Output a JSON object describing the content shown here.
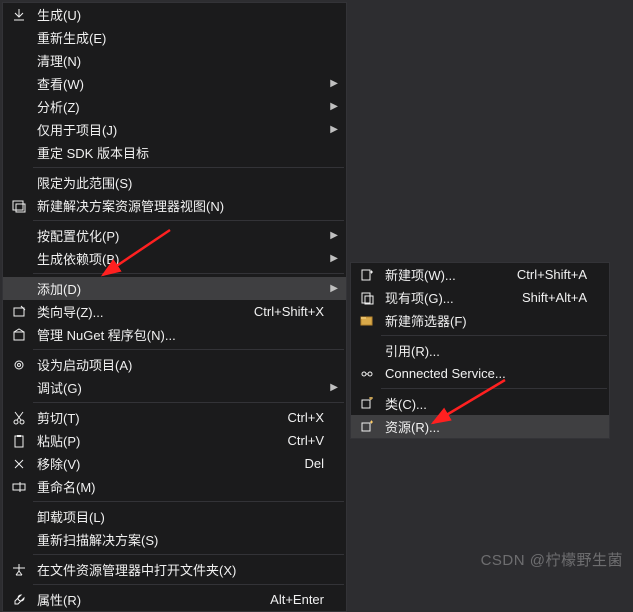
{
  "mainMenu": {
    "items": [
      {
        "id": "build",
        "label": "生成(U)",
        "icon": "build-icon",
        "sub": false
      },
      {
        "id": "rebuild",
        "label": "重新生成(E)",
        "icon": "",
        "sub": false
      },
      {
        "id": "clean",
        "label": "清理(N)",
        "icon": "",
        "sub": false
      },
      {
        "id": "view",
        "label": "查看(W)",
        "icon": "",
        "sub": true
      },
      {
        "id": "analyze",
        "label": "分析(Z)",
        "icon": "",
        "sub": true
      },
      {
        "id": "project-only",
        "label": "仅用于项目(J)",
        "icon": "",
        "sub": true
      },
      {
        "id": "retarget-sdk",
        "label": "重定 SDK 版本目标",
        "icon": "",
        "sub": false
      },
      {
        "sep": true
      },
      {
        "id": "scope",
        "label": "限定为此范围(S)",
        "icon": "",
        "sub": false
      },
      {
        "id": "new-view",
        "label": "新建解决方案资源管理器视图(N)",
        "icon": "newview-icon",
        "sub": false
      },
      {
        "sep": true
      },
      {
        "id": "pgo",
        "label": "按配置优化(P)",
        "icon": "",
        "sub": true
      },
      {
        "id": "build-deps",
        "label": "生成依赖项(B)",
        "icon": "",
        "sub": true
      },
      {
        "sep": true
      },
      {
        "id": "add",
        "label": "添加(D)",
        "icon": "",
        "sub": true,
        "highlight": true
      },
      {
        "id": "class-wizard",
        "label": "类向导(Z)...",
        "icon": "wizard-icon",
        "shortcut": "Ctrl+Shift+X"
      },
      {
        "id": "nuget",
        "label": "管理 NuGet 程序包(N)...",
        "icon": "nuget-icon",
        "sub": false
      },
      {
        "sep": true
      },
      {
        "id": "startup",
        "label": "设为启动项目(A)",
        "icon": "gear-icon",
        "sub": false
      },
      {
        "id": "debug",
        "label": "调试(G)",
        "icon": "",
        "sub": true
      },
      {
        "sep": true
      },
      {
        "id": "cut",
        "label": "剪切(T)",
        "icon": "cut-icon",
        "shortcut": "Ctrl+X"
      },
      {
        "id": "paste",
        "label": "粘贴(P)",
        "icon": "paste-icon",
        "shortcut": "Ctrl+V"
      },
      {
        "id": "remove",
        "label": "移除(V)",
        "icon": "remove-icon",
        "shortcut": "Del"
      },
      {
        "id": "rename",
        "label": "重命名(M)",
        "icon": "rename-icon",
        "sub": false
      },
      {
        "sep": true
      },
      {
        "id": "unload",
        "label": "卸载项目(L)",
        "icon": "",
        "sub": false
      },
      {
        "id": "rescan",
        "label": "重新扫描解决方案(S)",
        "icon": "",
        "sub": false
      },
      {
        "sep": true
      },
      {
        "id": "open-explorer",
        "label": "在文件资源管理器中打开文件夹(X)",
        "icon": "explorer-icon"
      },
      {
        "sep": true
      },
      {
        "id": "properties",
        "label": "属性(R)",
        "icon": "wrench-icon",
        "shortcut": "Alt+Enter"
      }
    ]
  },
  "subMenu": {
    "items": [
      {
        "id": "new-item",
        "label": "新建项(W)...",
        "icon": "newitem-icon",
        "shortcut": "Ctrl+Shift+A"
      },
      {
        "id": "exist-item",
        "label": "现有项(G)...",
        "icon": "existitem-icon",
        "shortcut": "Shift+Alt+A"
      },
      {
        "id": "new-filter",
        "label": "新建筛选器(F)",
        "icon": "filter-icon"
      },
      {
        "sep": true
      },
      {
        "id": "reference",
        "label": "引用(R)...",
        "icon": ""
      },
      {
        "id": "connected",
        "label": "Connected Service...",
        "icon": "service-icon"
      },
      {
        "sep": true
      },
      {
        "id": "class",
        "label": "类(C)...",
        "icon": "class-icon"
      },
      {
        "id": "resource",
        "label": "资源(R)...",
        "icon": "resource-icon",
        "highlight": true
      }
    ]
  },
  "watermark": "CSDN @柠檬野生菌"
}
